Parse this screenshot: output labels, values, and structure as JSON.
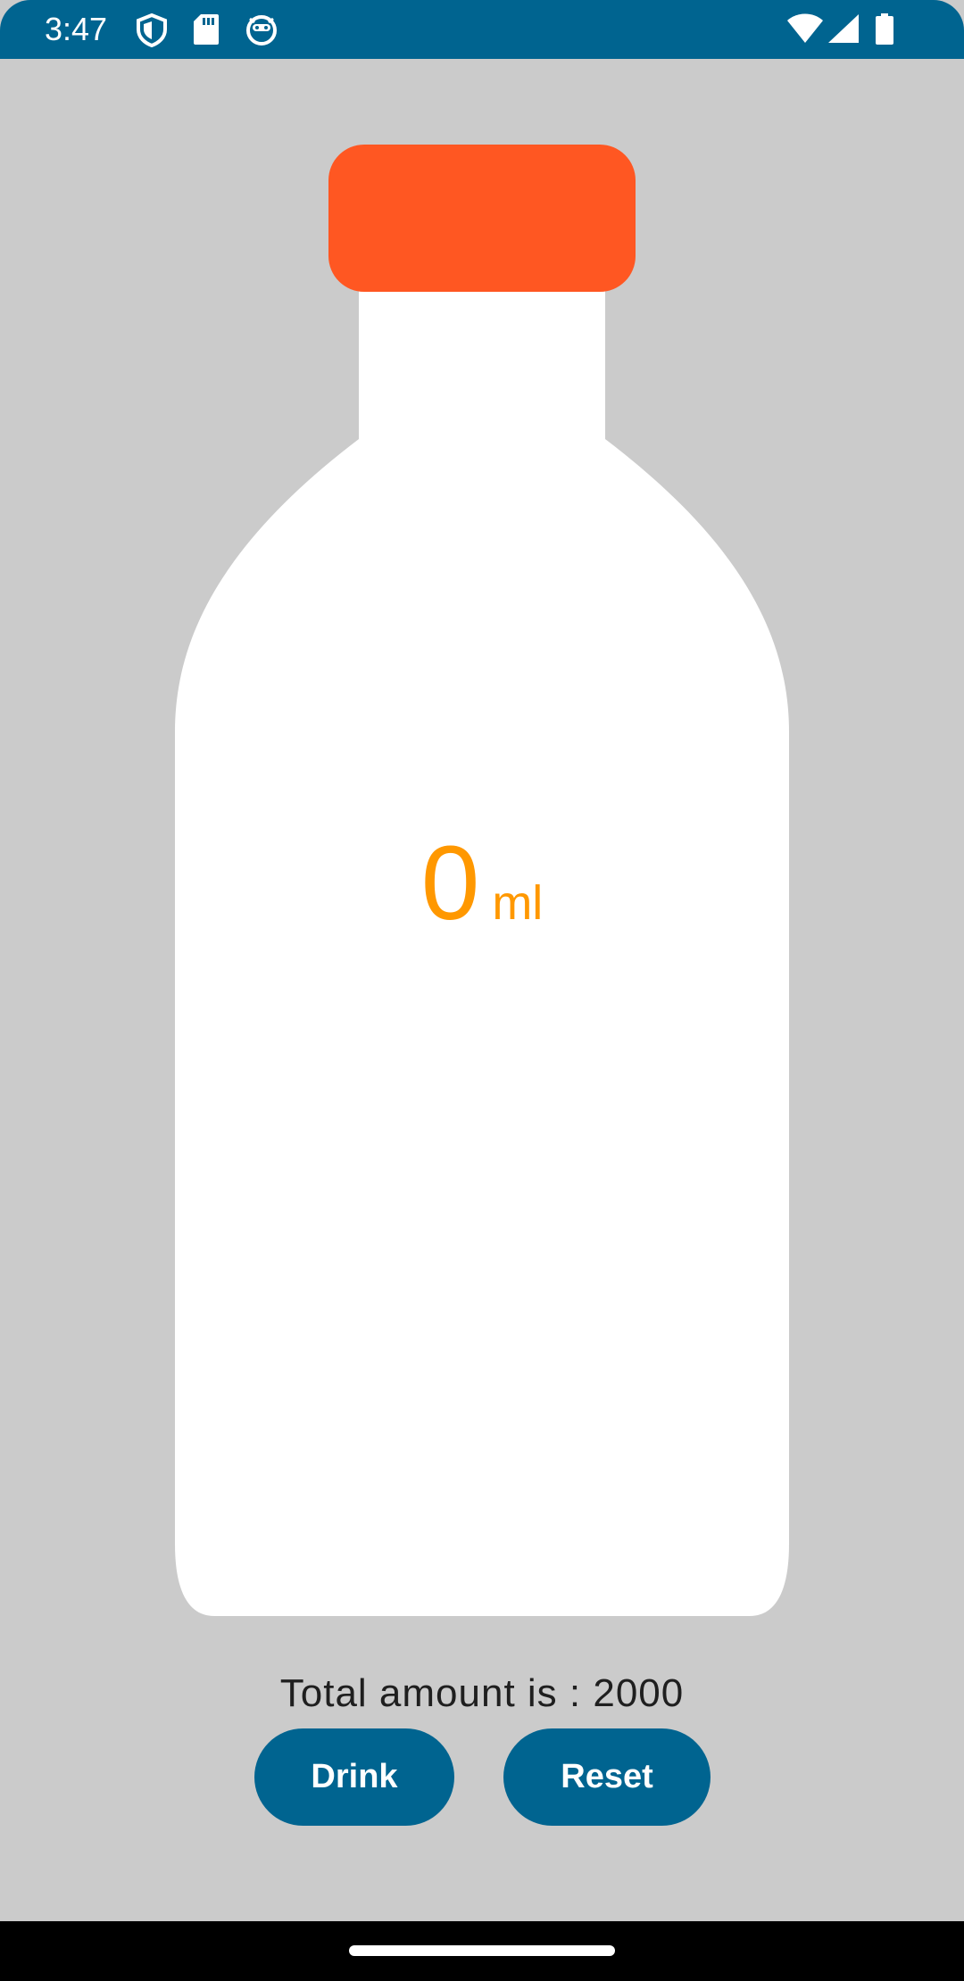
{
  "status_bar": {
    "time": "3:47",
    "left_icons": [
      "shield-icon",
      "sd-card-icon",
      "app-face-icon"
    ],
    "right_icons": [
      "wifi-icon",
      "cell-signal-icon",
      "battery-icon"
    ],
    "background_color": "#006490"
  },
  "bottle": {
    "cap_color": "#FF5722",
    "body_color": "#FFFFFF",
    "fill_fraction": 0
  },
  "amount": {
    "value": "0",
    "unit": "ml",
    "color": "#FF9800"
  },
  "total": {
    "label": "Total amount is : 2000"
  },
  "actions": {
    "drink_label": "Drink",
    "reset_label": "Reset",
    "button_color": "#006490"
  }
}
